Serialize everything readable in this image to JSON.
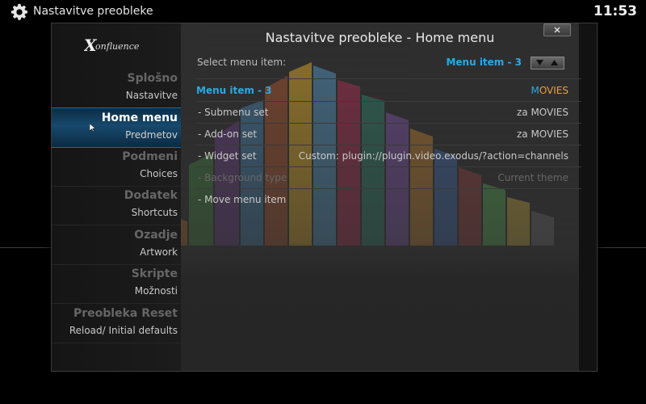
{
  "topbar": {
    "title": "Nastavitve preobleke",
    "clock": "11:53"
  },
  "dialog": {
    "title": "Nastavitve preobleke - Home menu",
    "logo_text": "Xonfluence"
  },
  "sidebar": {
    "items": [
      {
        "title": "Splošno",
        "subtitle": "Nastavitve"
      },
      {
        "title": "Home menu",
        "subtitle": "Predmetov"
      },
      {
        "title": "Podmeni",
        "subtitle": "Choices"
      },
      {
        "title": "Dodatek",
        "subtitle": "Shortcuts"
      },
      {
        "title": "Ozadje",
        "subtitle": "Artwork"
      },
      {
        "title": "Skripte",
        "subtitle": "Možnosti"
      },
      {
        "title": "Preobleka Reset",
        "subtitle": "Reload/ Initial defaults"
      }
    ]
  },
  "selector": {
    "label": "Select menu item:",
    "value": "Menu item - 3"
  },
  "header_row": {
    "label": "Menu item - 3",
    "value_first": "M",
    "value_rest": "OVIES"
  },
  "settings": [
    {
      "label": "- Submenu set",
      "value": "za MOVIES"
    },
    {
      "label": "- Add-on set",
      "value": "za MOVIES"
    },
    {
      "label": "- Widget set",
      "value": "Custom: plugin://plugin.video.exodus/?action=channels"
    },
    {
      "label": "- Background type",
      "value": "Current theme"
    },
    {
      "label": "- Move menu item",
      "value": ""
    }
  ],
  "colors": {
    "accent_blue": "#29a9e6",
    "accent_orange": "#e8a13c",
    "active_bg": "#16496d"
  }
}
